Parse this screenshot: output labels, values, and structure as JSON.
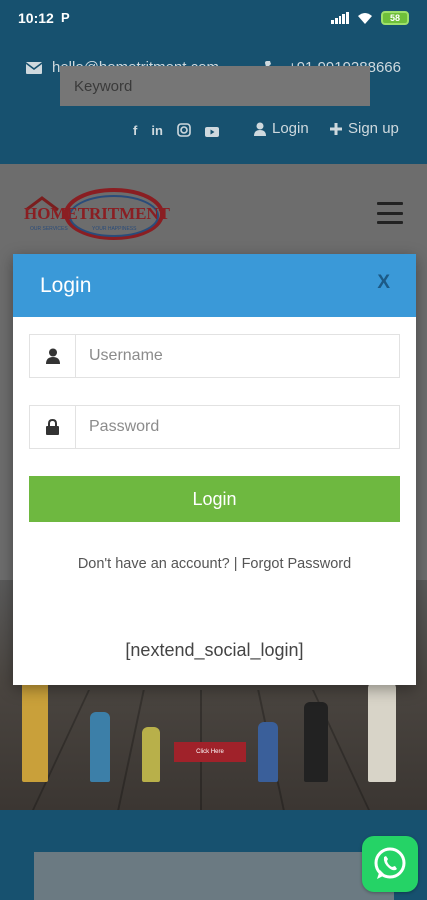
{
  "status_bar": {
    "time": "10:12",
    "p_icon": "P",
    "battery": "58"
  },
  "contact": {
    "email": "hello@hometritment.com",
    "phone": "+91 9919288666"
  },
  "social": {
    "login_label": "Login",
    "signup_label": "Sign up",
    "facebook": "f",
    "linkedin": "in"
  },
  "logo": {
    "brand": "HOMETRITMENT",
    "tagline_left": "OUR SERVICES",
    "tagline_right": "YOUR HAPPINESS"
  },
  "modal": {
    "title": "Login",
    "close_label": "X",
    "username_placeholder": "Username",
    "password_placeholder": "Password",
    "login_button": "Login",
    "no_account": "Don't have an account?",
    "separator": "|",
    "forgot_password": "Forgot Password",
    "social_shortcode": "[nextend_social_login]"
  },
  "hero": {
    "cta": "Click Here"
  },
  "search": {
    "keyword_placeholder": "Keyword"
  },
  "colors": {
    "dark_blue": "#17516f",
    "modal_header": "#3a99d8",
    "login_green": "#6eb840",
    "whatsapp": "#25d366"
  }
}
